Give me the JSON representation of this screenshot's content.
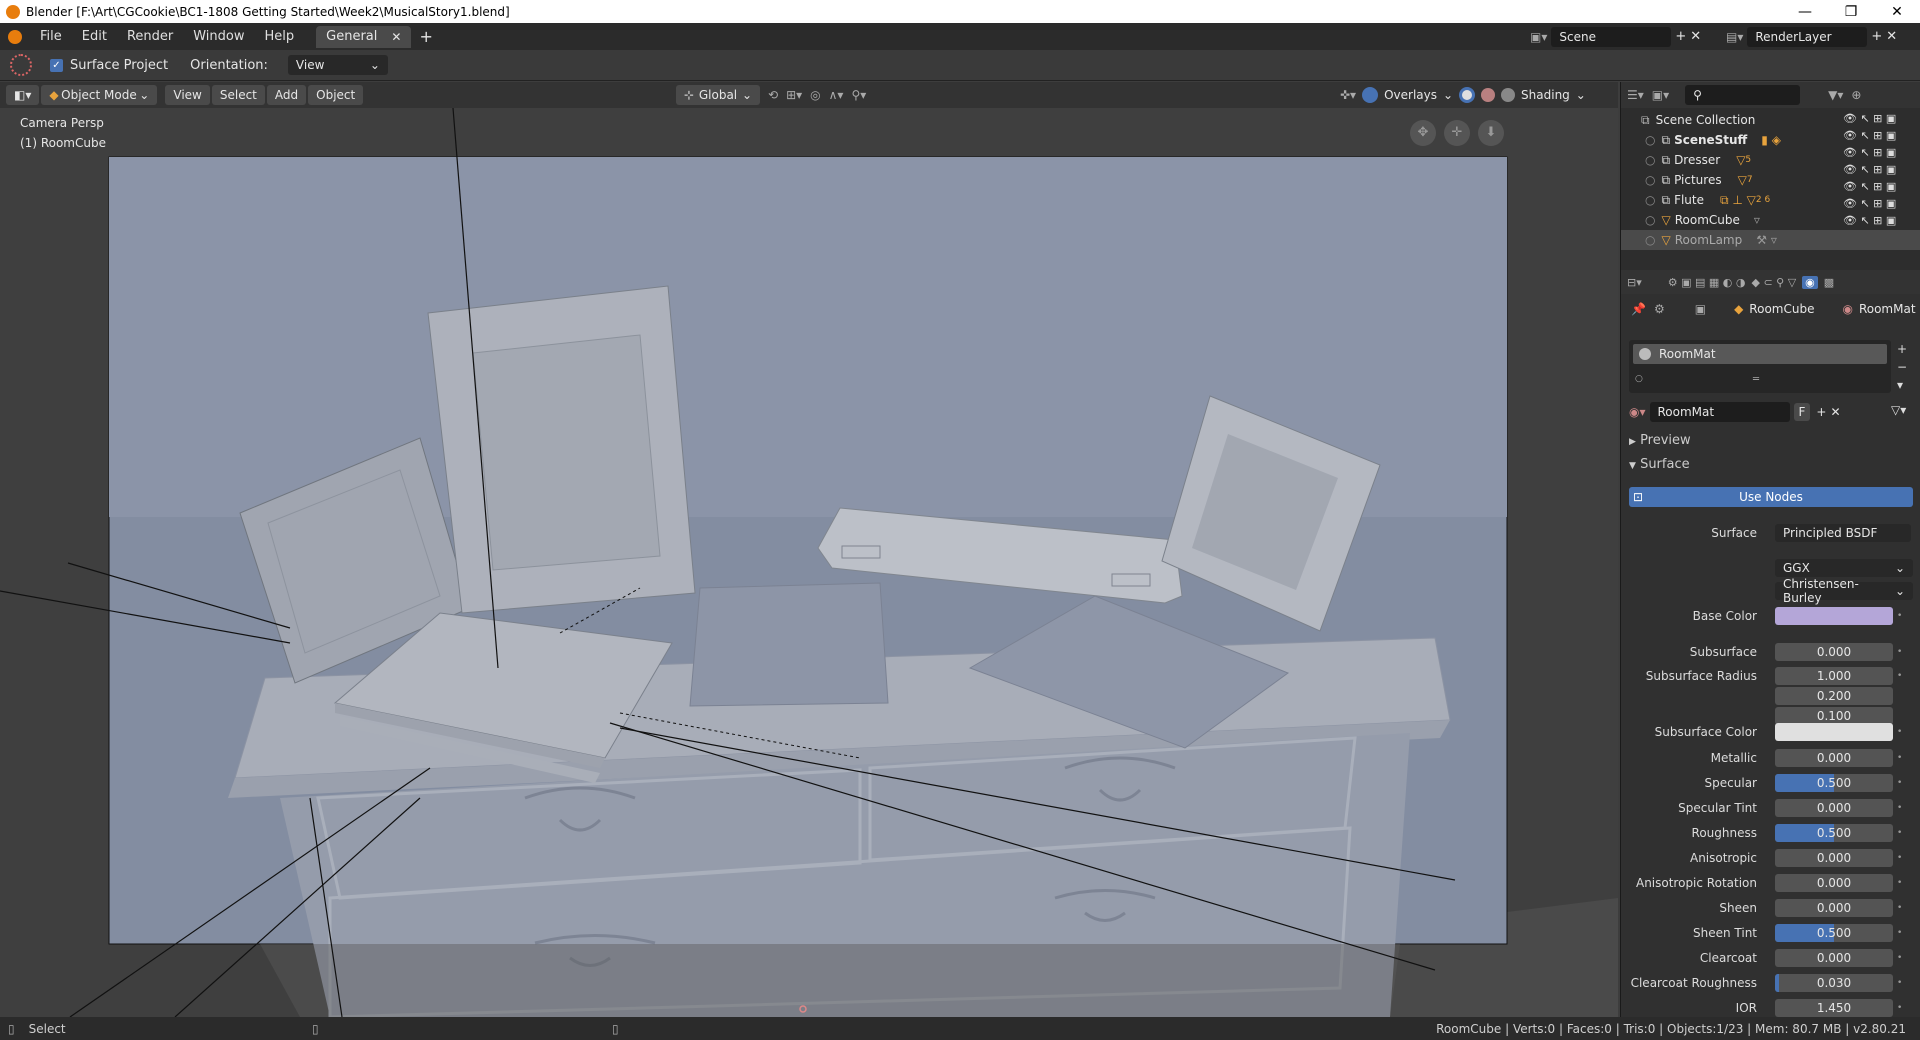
{
  "window": {
    "title": "Blender [F:\\Art\\CGCookie\\BC1-1808 Getting Started\\Week2\\MusicalStory1.blend]",
    "controls": [
      "—",
      "❐",
      "✕"
    ]
  },
  "menu": [
    "File",
    "Edit",
    "Render",
    "Window",
    "Help"
  ],
  "workspace_tab": {
    "label": "General",
    "close": "✕",
    "add": "+"
  },
  "scene": {
    "label": "Scene",
    "add": "+",
    "remove": "✕"
  },
  "render_layer": {
    "label": "RenderLayer",
    "add": "+",
    "remove": "✕"
  },
  "tool_settings": {
    "surface_project_label": "Surface Project",
    "surface_project_checked": true,
    "orientation_label": "Orientation:",
    "orientation_value": "View"
  },
  "viewport_header": {
    "mode": "Object Mode",
    "menus": [
      "View",
      "Select",
      "Add",
      "Object"
    ],
    "transform_orientation": "Global",
    "overlays": "Overlays",
    "shading": "Shading"
  },
  "viewport": {
    "camera_label": "Camera Persp",
    "object_label": "(1) RoomCube"
  },
  "outliner": {
    "search_placeholder": "",
    "root": "Scene Collection",
    "items": [
      {
        "name": "SceneStuff",
        "extra": "",
        "bold": true
      },
      {
        "name": "Dresser",
        "extra": "5",
        "bold": false
      },
      {
        "name": "Pictures",
        "extra": "7",
        "bold": false
      },
      {
        "name": "Flute",
        "extra": "2 6",
        "bold": false
      },
      {
        "name": "RoomCube",
        "extra": "",
        "bold": false
      },
      {
        "name": "RoomLamp",
        "extra": "",
        "bold": false,
        "selected": true
      }
    ]
  },
  "properties": {
    "breadcrumb": [
      "RoomCube",
      "RoomMat"
    ],
    "slot_name": "RoomMat",
    "material_name": "RoomMat",
    "material_fake_user": "F",
    "panels": {
      "preview": "Preview",
      "surface": "Surface"
    },
    "use_nodes": "Use Nodes",
    "surface_label": "Surface",
    "surface_value": "Principled BSDF",
    "distribution": "GGX",
    "subsurface_method": "Christensen-Burley",
    "base_color_label": "Base Color",
    "base_color": "#b4a6d8",
    "subsurface_color_label": "Subsurface Color",
    "subsurface_color": "#e0e0e0",
    "fields": [
      {
        "label": "Subsurface",
        "value": "0.000",
        "fill": 0
      },
      {
        "label": "Subsurface Radius",
        "value": "1.000",
        "fill": 0
      },
      {
        "label": "",
        "value": "0.200",
        "fill": 0
      },
      {
        "label": "",
        "value": "0.100",
        "fill": 0
      },
      {
        "label": "Metallic",
        "value": "0.000",
        "fill": 0
      },
      {
        "label": "Specular",
        "value": "0.500",
        "fill": 0.5
      },
      {
        "label": "Specular Tint",
        "value": "0.000",
        "fill": 0
      },
      {
        "label": "Roughness",
        "value": "0.500",
        "fill": 0.5
      },
      {
        "label": "Anisotropic",
        "value": "0.000",
        "fill": 0
      },
      {
        "label": "Anisotropic Rotation",
        "value": "0.000",
        "fill": 0
      },
      {
        "label": "Sheen",
        "value": "0.000",
        "fill": 0
      },
      {
        "label": "Sheen Tint",
        "value": "0.500",
        "fill": 0.5
      },
      {
        "label": "Clearcoat",
        "value": "0.000",
        "fill": 0
      },
      {
        "label": "Clearcoat Roughness",
        "value": "0.030",
        "fill": 0.03
      },
      {
        "label": "IOR",
        "value": "1.450",
        "fill": 0
      }
    ]
  },
  "status": {
    "left": "Select",
    "right": "RoomCube | Verts:0 | Faces:0 | Tris:0 | Objects:1/23 | Mem: 80.7 MB | v2.80.21"
  }
}
